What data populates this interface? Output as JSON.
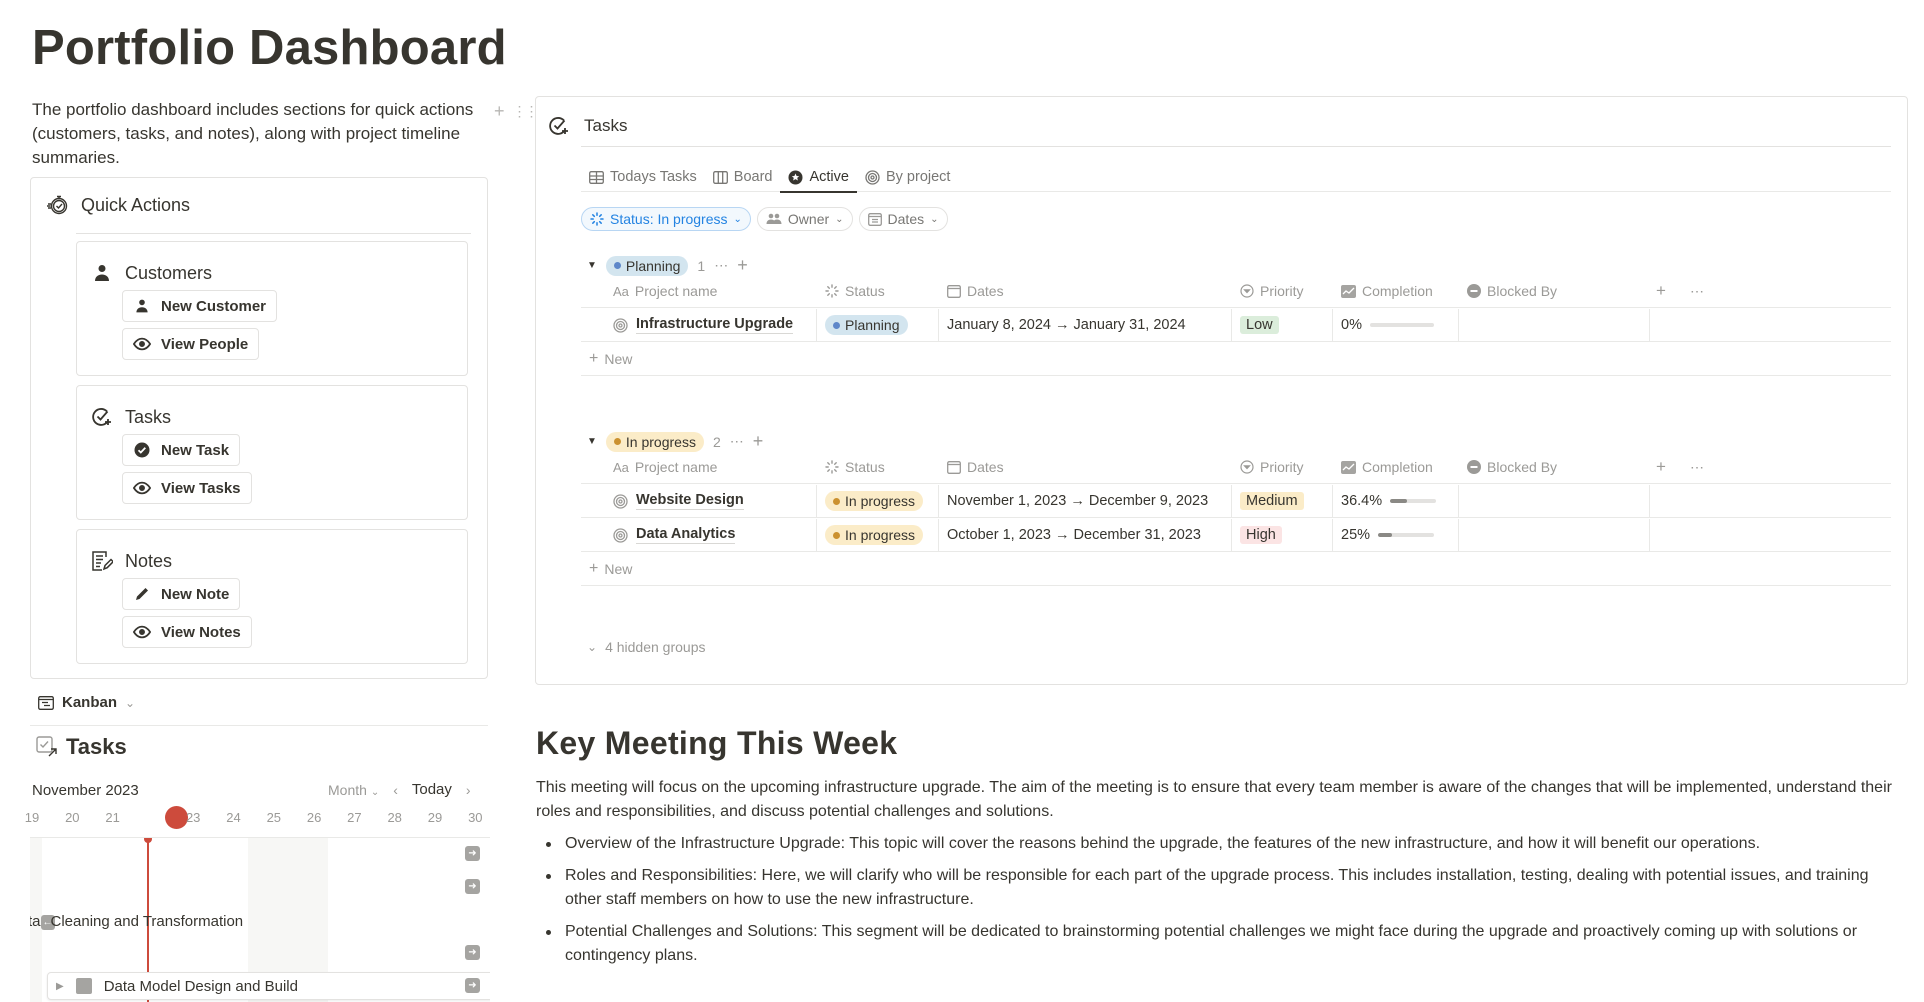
{
  "page": {
    "title": "Portfolio Dashboard",
    "intro": "The portfolio dashboard includes sections for quick actions (customers, tasks, and notes), along with project timeline summaries."
  },
  "quick_actions": {
    "title": "Quick Actions",
    "sections": [
      {
        "title": "Customers",
        "icon": "person-icon",
        "buttons": [
          {
            "label": "New Customer",
            "icon": "person-icon"
          },
          {
            "label": "View People",
            "icon": "eye-icon"
          }
        ]
      },
      {
        "title": "Tasks",
        "icon": "check-plus-icon",
        "buttons": [
          {
            "label": "New Task",
            "icon": "check-circle-icon"
          },
          {
            "label": "View Tasks",
            "icon": "eye-icon"
          }
        ]
      },
      {
        "title": "Notes",
        "icon": "note-icon",
        "buttons": [
          {
            "label": "New Note",
            "icon": "pencil-icon"
          },
          {
            "label": "View Notes",
            "icon": "eye-icon"
          }
        ]
      }
    ]
  },
  "timeline": {
    "view_selector": "Kanban",
    "title": "Tasks",
    "month": "November 2023",
    "scale": "Month",
    "today_label": "Today",
    "days": [
      "19",
      "20",
      "21",
      "22",
      "23",
      "24",
      "25",
      "26",
      "27",
      "28",
      "29",
      "30"
    ],
    "today_day": "22",
    "items": [
      {
        "label": "Data Cleaning and Transformation"
      },
      {
        "label": "Data Model Design and Build"
      }
    ]
  },
  "tasks_panel": {
    "title": "Tasks",
    "tabs": [
      {
        "label": "Todays Tasks",
        "icon": "table-icon",
        "active": false
      },
      {
        "label": "Board",
        "icon": "board-icon",
        "active": false
      },
      {
        "label": "Active",
        "icon": "star-circle-icon",
        "active": true
      },
      {
        "label": "By project",
        "icon": "target-icon",
        "active": false
      }
    ],
    "filters": [
      {
        "label": "Status: In progress",
        "active": true
      },
      {
        "label": "Owner",
        "active": false
      },
      {
        "label": "Dates",
        "active": false
      }
    ],
    "columns": [
      "Project name",
      "Status",
      "Dates",
      "Priority",
      "Completion",
      "Blocked By"
    ],
    "column_prefix": "Aa",
    "groups": [
      {
        "name": "Planning",
        "count": "1",
        "rows": [
          {
            "name": "Infrastructure Upgrade",
            "status": "Planning",
            "dates": "January 8, 2024 → January 31, 2024",
            "priority": "Low",
            "completion_label": "0%",
            "completion": 0.0,
            "blocked_by": ""
          }
        ]
      },
      {
        "name": "In progress",
        "count": "2",
        "rows": [
          {
            "name": "Website Design",
            "status": "In progress",
            "dates": "November 1, 2023 → December 9, 2023",
            "priority": "Medium",
            "completion_label": "36.4%",
            "completion": 0.364,
            "blocked_by": ""
          },
          {
            "name": "Data Analytics",
            "status": "In progress",
            "dates": "October 1, 2023 → December 31, 2023",
            "priority": "High",
            "completion_label": "25%",
            "completion": 0.25,
            "blocked_by": ""
          }
        ]
      }
    ],
    "new_label": "New",
    "hidden_groups": "4 hidden groups"
  },
  "key_meeting": {
    "title": "Key Meeting This Week",
    "body": "This meeting will focus on the upcoming infrastructure upgrade. The aim of the meeting is to ensure that every team member is aware of the changes that will be implemented, understand their roles and responsibilities, and discuss potential challenges and solutions.",
    "bullets": [
      "Overview of the Infrastructure Upgrade: This topic will cover the reasons behind the upgrade, the features of the new infrastructure, and how it will benefit our operations.",
      "Roles and Responsibilities: Here, we will clarify who will be responsible for each part of the upgrade process. This includes installation, testing, dealing with potential issues, and training other staff members on how to use the new infrastructure.",
      "Potential Challenges and Solutions: This segment will be dedicated to brainstorming potential challenges we might face during the upgrade and proactively coming up with solutions or contingency plans."
    ]
  },
  "colors": {
    "text": "#37352f",
    "muted": "#9b9a97",
    "accent_blue": "#2383e2",
    "today_red": "#cd4b3c",
    "planning_bg": "#d3e5ef",
    "in_progress_bg": "#fbecc8",
    "priority_low": "#dbeddb",
    "priority_medium": "#fbecc8",
    "priority_high": "#fbe4e4"
  }
}
